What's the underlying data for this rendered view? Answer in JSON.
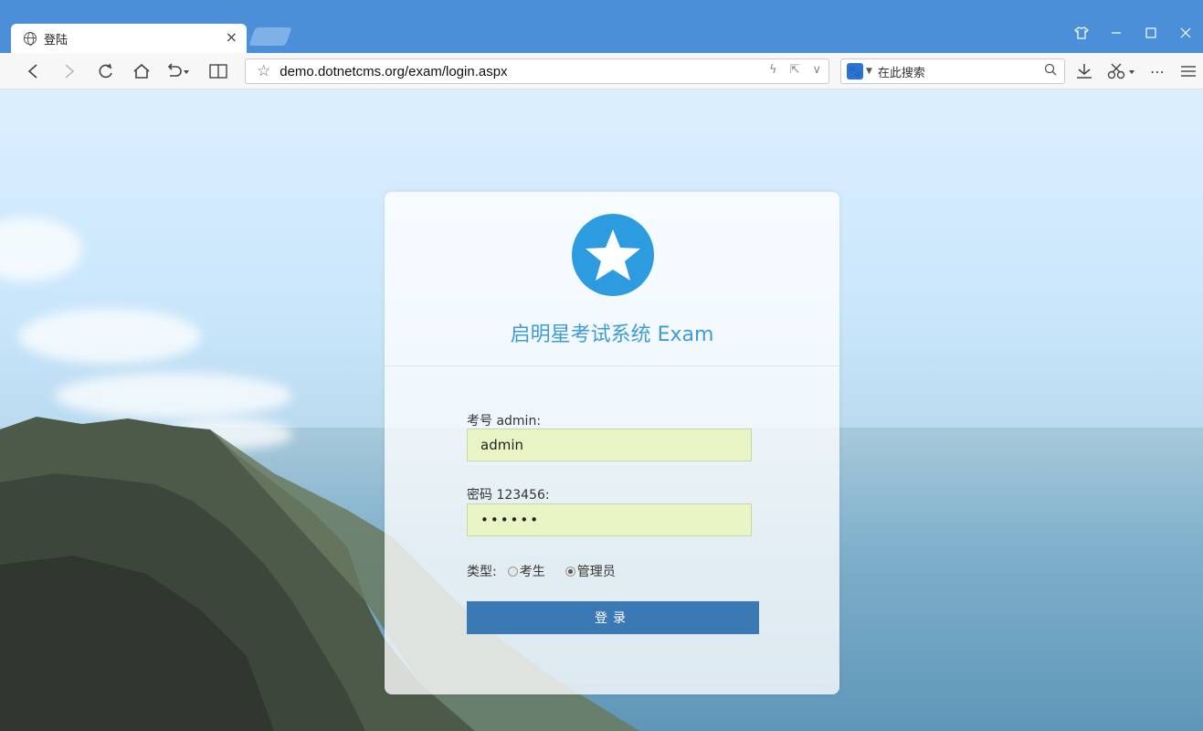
{
  "browser": {
    "tab_title": "登陆",
    "tab_close": "×",
    "url": "demo.dotnetcms.org/exam/login.aspx",
    "search_placeholder": "在此搜索",
    "window_controls": [
      "shirt-icon",
      "minimize-icon",
      "maximize-icon",
      "close-icon"
    ]
  },
  "login": {
    "app_title": "启明星考试系统 Exam",
    "username_label": "考号 admin:",
    "username_value": "admin",
    "password_label": "密码 123456:",
    "password_value": "••••••",
    "type_label": "类型:",
    "type_options": [
      {
        "label": "考生",
        "selected": false
      },
      {
        "label": "管理员",
        "selected": true
      }
    ],
    "submit_label": "登录"
  },
  "colors": {
    "titlebar": "#4a8fd8",
    "accent": "#2d9be0",
    "title_text": "#3c9bd8",
    "input_bg": "#e8f4c4",
    "button_bg": "#3b79b5"
  }
}
